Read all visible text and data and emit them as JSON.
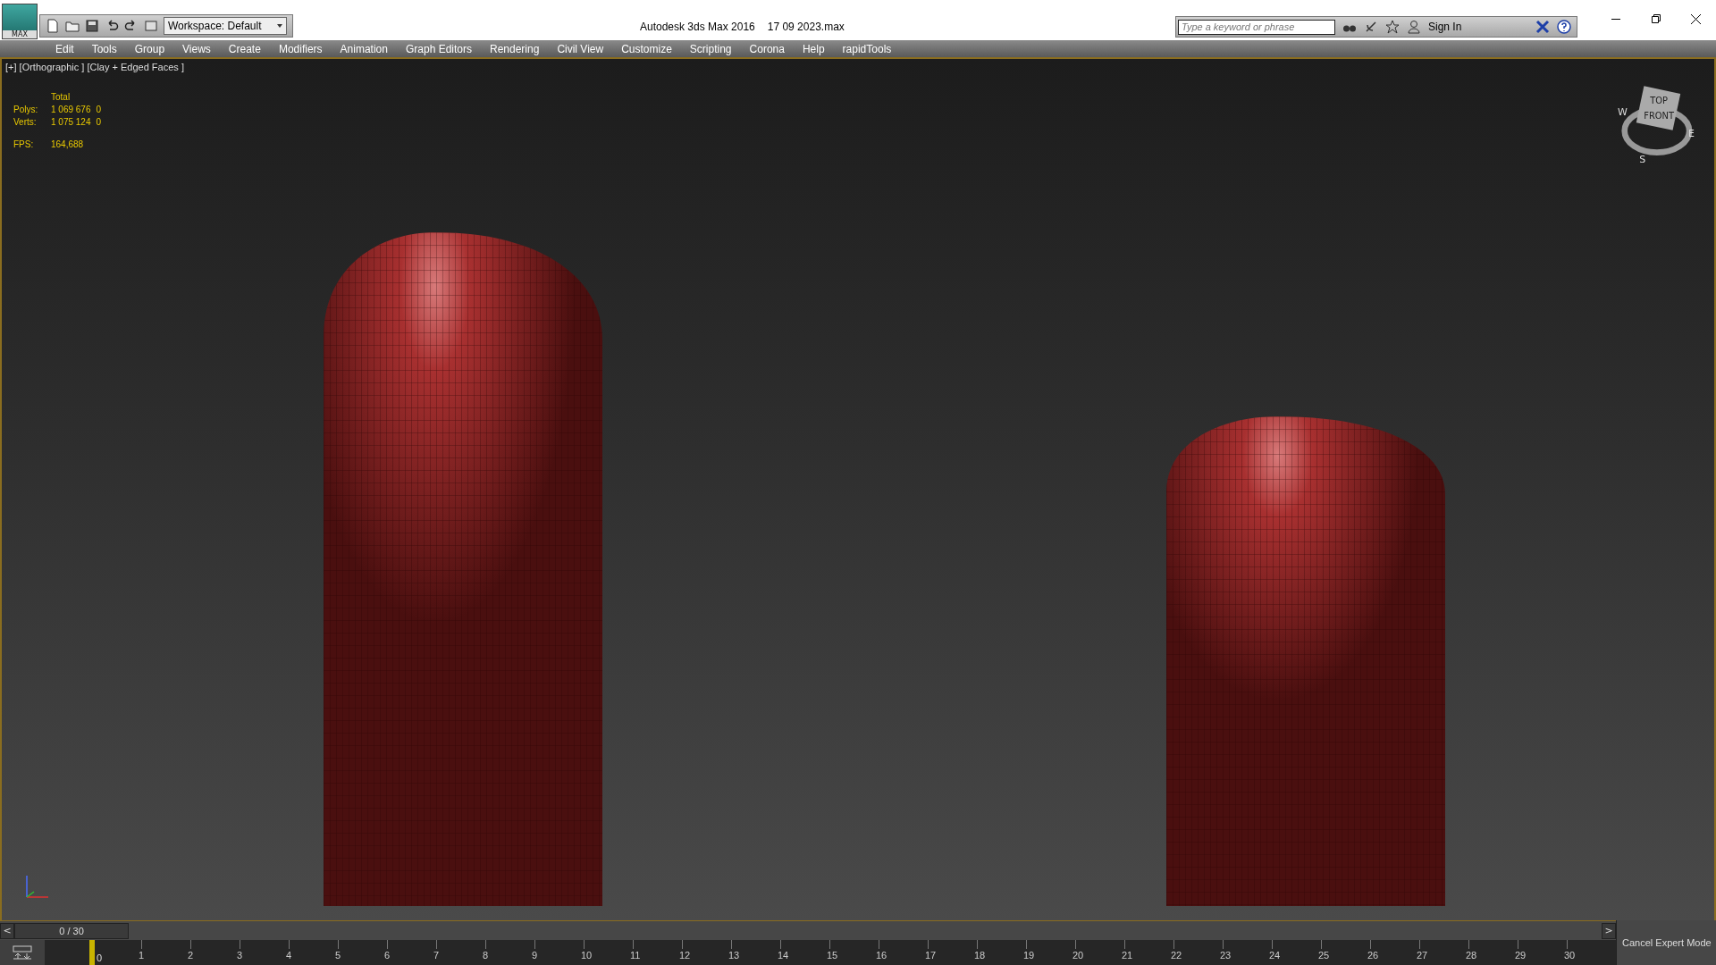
{
  "title_bar": {
    "app_badge": "MAX",
    "workspace": "Workspace: Default",
    "app_title": "Autodesk 3ds Max 2016",
    "file_name": "17 09 2023.max",
    "search": {
      "placeholder": "Type a keyword or phrase"
    },
    "sign_in": "Sign In"
  },
  "menu": [
    "Edit",
    "Tools",
    "Group",
    "Views",
    "Create",
    "Modifiers",
    "Animation",
    "Graph Editors",
    "Rendering",
    "Civil View",
    "Customize",
    "Scripting",
    "Corona",
    "Help",
    "rapidTools"
  ],
  "viewport": {
    "label": "[+] [Orthographic ] [Clay + Edged Faces ]",
    "stats": {
      "header": "Total",
      "rows": [
        {
          "label": "Polys:",
          "value": "1 069 676",
          "selected_value": "0"
        },
        {
          "label": "Verts:",
          "value": "1 075 124",
          "selected_value": "0"
        }
      ],
      "fps_label": "FPS:",
      "fps": "164,688"
    },
    "viewcube": {
      "top": "TOP",
      "front": "FRONT",
      "west": "W",
      "east": "E",
      "south": "S"
    }
  },
  "time_slider": {
    "frame": "0 / 30",
    "prev": "<",
    "next": ">",
    "level": 0
  },
  "track_bar": {
    "ticks": [
      {
        "label": "0",
        "selected": true
      },
      {
        "label": "1",
        "selected": false
      },
      {
        "label": "2",
        "selected": false
      },
      {
        "label": "3",
        "selected": false
      },
      {
        "label": "4",
        "selected": false
      },
      {
        "label": "5",
        "selected": false
      },
      {
        "label": "6",
        "selected": false
      },
      {
        "label": "7",
        "selected": false
      },
      {
        "label": "8",
        "selected": false
      },
      {
        "label": "9",
        "selected": false
      },
      {
        "label": "10",
        "selected": false
      },
      {
        "label": "11",
        "selected": false
      },
      {
        "label": "12",
        "selected": false
      },
      {
        "label": "13",
        "selected": false
      },
      {
        "label": "14",
        "selected": false
      },
      {
        "label": "15",
        "selected": false
      },
      {
        "label": "16",
        "selected": false
      },
      {
        "label": "17",
        "selected": false
      },
      {
        "label": "18",
        "selected": false
      },
      {
        "label": "19",
        "selected": false
      },
      {
        "label": "20",
        "selected": false
      },
      {
        "label": "21",
        "selected": false
      },
      {
        "label": "22",
        "selected": false
      },
      {
        "label": "23",
        "selected": false
      },
      {
        "label": "24",
        "selected": false
      },
      {
        "label": "25",
        "selected": false
      },
      {
        "label": "26",
        "selected": false
      },
      {
        "label": "27",
        "selected": false
      },
      {
        "label": "28",
        "selected": false
      },
      {
        "label": "29",
        "selected": false
      },
      {
        "label": "30",
        "selected": false
      }
    ]
  },
  "expert_mode_button": "Cancel Expert Mode"
}
